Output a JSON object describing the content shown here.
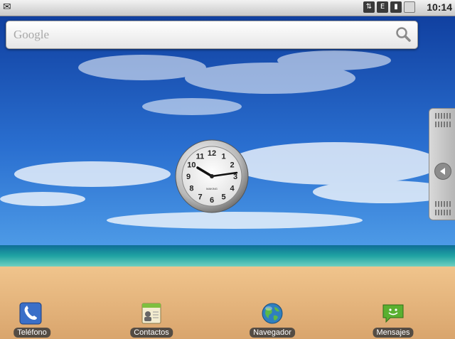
{
  "status_bar": {
    "notification_icon": "email-notification-icon",
    "icons": [
      "network-icon",
      "signal-e-icon",
      "signal-bars-icon",
      "battery-icon"
    ],
    "time": "10:14"
  },
  "search": {
    "placeholder": "Google",
    "icon": "search-icon"
  },
  "clock_widget": {
    "brand": "MAKING",
    "numerals": [
      "12",
      "1",
      "2",
      "3",
      "4",
      "5",
      "6",
      "7",
      "8",
      "9",
      "10",
      "11"
    ],
    "time_shown": "10:14"
  },
  "dock": [
    {
      "label": "Teléfono",
      "icon": "phone-icon",
      "color": "#3a6fc8"
    },
    {
      "label": "Contactos",
      "icon": "contacts-icon",
      "color": "#d9c88a"
    },
    {
      "label": "Navegador",
      "icon": "globe-icon",
      "color": "#2f7fbf"
    },
    {
      "label": "Mensajes",
      "icon": "messages-icon",
      "color": "#5ab030"
    }
  ],
  "colors": {
    "sky": "#1a4fa8",
    "sea": "#1f9aa0",
    "sand": "#e2b47a"
  }
}
